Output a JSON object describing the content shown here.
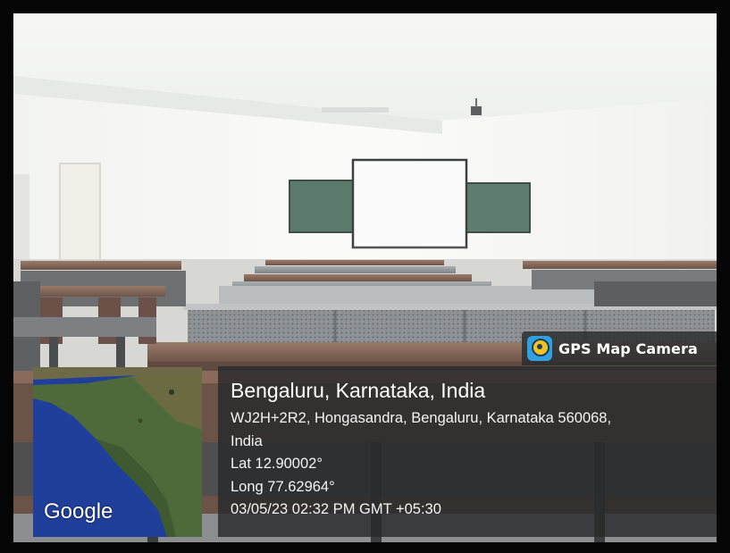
{
  "badge": {
    "app_name": "GPS Map Camera",
    "icon": "gps-map-camera-logo-icon"
  },
  "map": {
    "provider_logo": "Google"
  },
  "location": {
    "title": "Bengaluru, Karnataka, India",
    "address_line1": "WJ2H+2R2, Hongasandra, Bengaluru, Karnataka 560068,",
    "address_line2": "India",
    "latitude": "Lat 12.90002°",
    "longitude": "Long 77.62964°",
    "timestamp": "03/05/23 02:32 PM GMT +05:30"
  },
  "colors": {
    "overlay": "#26282a",
    "chalkboard": "#5b7a6c",
    "bench_top": "#8a6a5a",
    "map_ocean": "#1f3f9a",
    "map_land": "#4e6a3a"
  }
}
